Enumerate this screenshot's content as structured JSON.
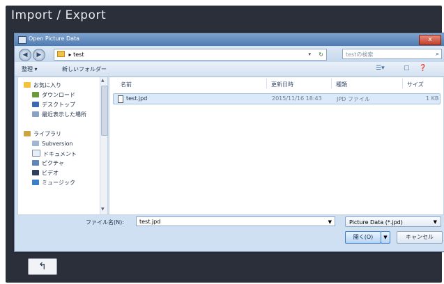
{
  "app": {
    "title": "Import / Export"
  },
  "dialog": {
    "title": "Open Picture Data",
    "close_label": "x",
    "address": {
      "path": "test",
      "separator": "▸"
    },
    "search": {
      "placeholder": "testの検索"
    },
    "toolbar": {
      "organize": "整理 ▾",
      "new_folder": "新しいフォルダー"
    },
    "nav": {
      "favorites": "お気に入り",
      "items_fav": [
        "ダウンロード",
        "デスクトップ",
        "最近表示した場所"
      ],
      "library": "ライブラリ",
      "items_lib": [
        "Subversion",
        "ドキュメント",
        "ピクチャ",
        "ビデオ",
        "ミュージック"
      ]
    },
    "columns": [
      "名前",
      "更新日時",
      "種類",
      "サイズ"
    ],
    "files": [
      {
        "name": "test.jpd",
        "modified": "2015/11/16 18:43",
        "type": "JPD ファイル",
        "size": "1 KB"
      }
    ],
    "filename_label": "ファイル名(N):",
    "filename_value": "test.jpd",
    "filetype": "Picture Data (*.jpd)",
    "open_label": "開く(O)",
    "cancel_label": "キャンセル"
  },
  "footer": {
    "back_icon": "return-arrow-icon",
    "back_glyph": "↰"
  },
  "colors": {
    "panel_bg": "#2b2f3a",
    "dialog_bg": "#cfe0f2",
    "accent": "#3c7fc7"
  }
}
